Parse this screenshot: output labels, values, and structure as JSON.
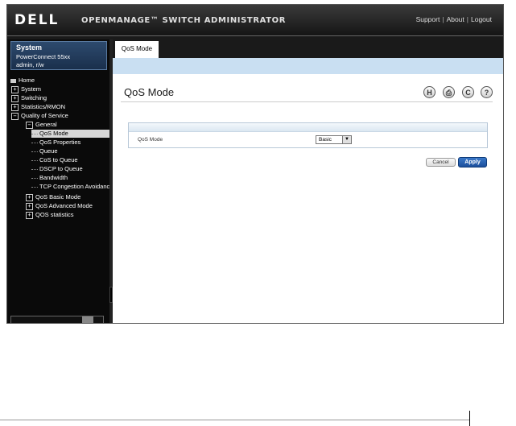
{
  "header": {
    "logo": "DELL",
    "app_title": "OPENMANAGE™ SWITCH ADMINISTRATOR",
    "links": [
      "Support",
      "About",
      "Logout"
    ],
    "separator": "|"
  },
  "system": {
    "title": "System",
    "model": "PowerConnect 55xx",
    "user": "admin, r/w"
  },
  "tree": {
    "home": "Home",
    "system": "System",
    "switching": "Switching",
    "stats": "Statistics/RMON",
    "qos": "Quality of Service",
    "general": "General",
    "qos_mode": "QoS Mode",
    "qos_properties": "QoS Properties",
    "queue": "Queue",
    "cos_to_queue": "CoS to Queue",
    "dscp_to_queue": "DSCP to Queue",
    "bandwidth": "Bandwidth",
    "tcp_congestion": "TCP Congestion Avoidance",
    "qos_basic": "QoS Basic Mode",
    "qos_advanced": "QoS Advanced Mode",
    "qos_statistics": "QOS statistics",
    "plus": "+",
    "minus": "−"
  },
  "tab": {
    "label": "QoS Mode"
  },
  "page": {
    "title": "QoS Mode",
    "tool_icons": {
      "save": "H",
      "print": "⎙",
      "refresh": "C",
      "help": "?"
    }
  },
  "form": {
    "qos_mode_label": "QoS Mode",
    "qos_mode_value": "Basic",
    "dropdown_arrow": "▼"
  },
  "buttons": {
    "cancel": "Cancel",
    "apply": "Apply"
  }
}
